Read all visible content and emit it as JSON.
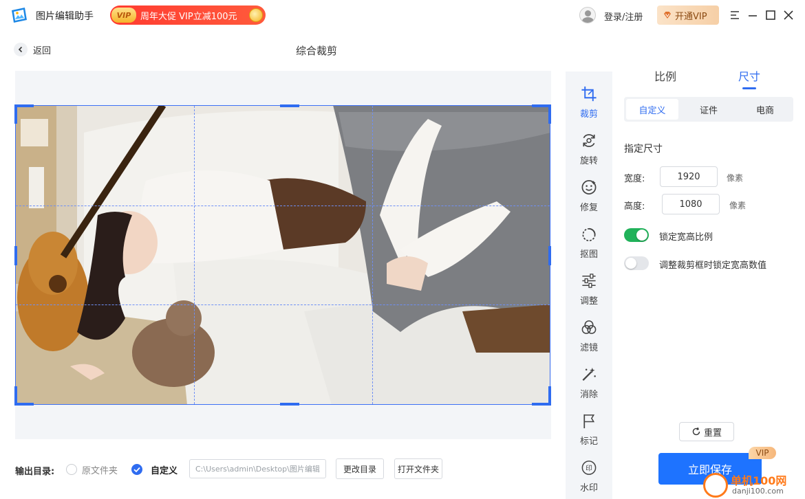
{
  "app": {
    "name": "图片编辑助手",
    "promo": {
      "badge": "VIP",
      "text": "周年大促 VIP立减100元"
    },
    "login_label": "登录/注册",
    "vip_button": "开通VIP"
  },
  "header": {
    "back_label": "返回",
    "title": "综合裁剪"
  },
  "tools": [
    {
      "label": "裁剪",
      "icon": "crop-icon",
      "active": true
    },
    {
      "label": "旋转",
      "icon": "rotate-icon"
    },
    {
      "label": "修复",
      "icon": "face-repair-icon"
    },
    {
      "label": "抠图",
      "icon": "cutout-icon"
    },
    {
      "label": "调整",
      "icon": "adjust-sliders-icon"
    },
    {
      "label": "滤镜",
      "icon": "filter-icon"
    },
    {
      "label": "消除",
      "icon": "magic-wand-icon"
    },
    {
      "label": "标记",
      "icon": "flag-icon"
    },
    {
      "label": "水印",
      "icon": "watermark-icon"
    }
  ],
  "panel": {
    "tabs": [
      {
        "label": "比例",
        "active": false
      },
      {
        "label": "尺寸",
        "active": true
      }
    ],
    "segments": [
      {
        "label": "自定义",
        "active": true
      },
      {
        "label": "证件",
        "active": false
      },
      {
        "label": "电商",
        "active": false
      }
    ],
    "section_title": "指定尺寸",
    "width": {
      "label": "宽度:",
      "value": "1920",
      "unit": "像素"
    },
    "height": {
      "label": "高度:",
      "value": "1080",
      "unit": "像素"
    },
    "lock_ratio": {
      "label": "锁定宽高比例",
      "on": true
    },
    "lock_values": {
      "label": "调整裁剪框时锁定宽高数值",
      "on": false
    },
    "reset_label": "重置",
    "save_label": "立即保存",
    "save_badge": "VIP"
  },
  "output": {
    "label": "输出目录:",
    "option_original": "原文件夹",
    "option_custom": "自定义",
    "selected": "自定义",
    "path": "C:\\Users\\admin\\Desktop\\图片编辑",
    "change_dir": "更改目录",
    "open_folder": "打开文件夹"
  },
  "watermark": {
    "brand": "单机100网",
    "domain": "danji100.com"
  },
  "colors": {
    "accent": "#2f6cf0",
    "save": "#1e73ff",
    "toggle_on": "#21b25a",
    "promo": "#ff3b30"
  }
}
